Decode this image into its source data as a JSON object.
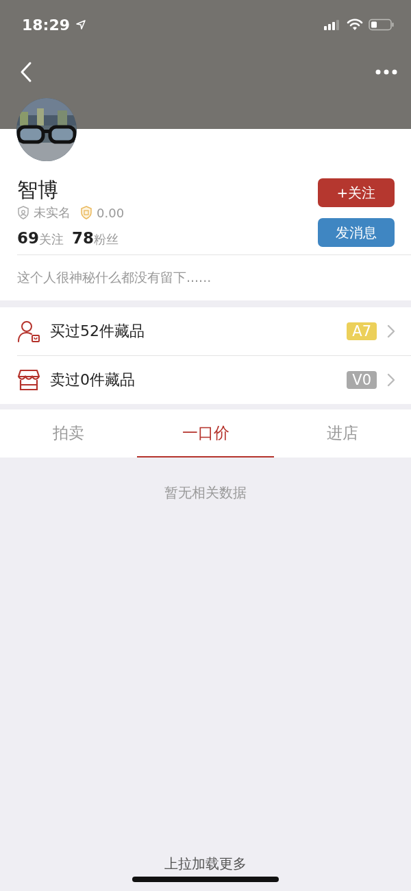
{
  "status_bar": {
    "time": "18:29"
  },
  "profile": {
    "name": "智博",
    "verification": "未实名",
    "deposit": "0.00",
    "following_count": "69",
    "following_label": "关注",
    "followers_count": "78",
    "followers_label": "粉丝",
    "bio": "这个人很神秘什么都没有留下......"
  },
  "buttons": [
    {
      "kind": "follow",
      "label": "+关注"
    },
    {
      "kind": "message",
      "label": "发消息"
    }
  ],
  "records": [
    {
      "kind": "bought",
      "label": "买过52件藏品",
      "badge": "A7",
      "color": "#ecd05a"
    },
    {
      "kind": "sold",
      "label": "卖过0件藏品",
      "badge": "V0",
      "color": "#a9a9a9"
    }
  ],
  "tabs": [
    {
      "label": "拍卖",
      "selected": false
    },
    {
      "label": "一口价",
      "selected": true
    },
    {
      "label": "进店",
      "selected": false
    }
  ],
  "empty_message": "暂无相关数据",
  "load_more": "上拉加载更多"
}
